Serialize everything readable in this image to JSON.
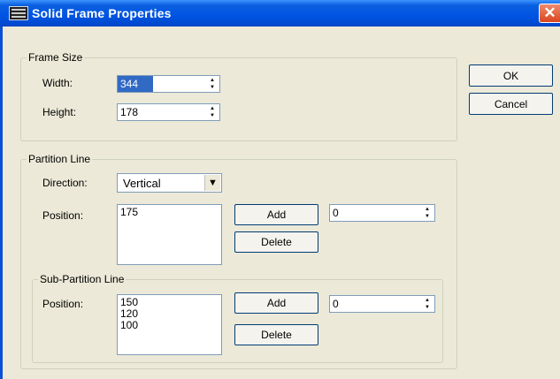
{
  "window": {
    "title": "Solid Frame Properties"
  },
  "frame_size": {
    "legend": "Frame Size",
    "width_label": "Width:",
    "width_value": "344",
    "height_label": "Height:",
    "height_value": "178"
  },
  "partition": {
    "legend": "Partition Line",
    "direction_label": "Direction:",
    "direction_value": "Vertical",
    "position_label": "Position:",
    "positions": [
      "175"
    ],
    "add_label": "Add",
    "delete_label": "Delete",
    "spin_value": "0"
  },
  "sub_partition": {
    "legend": "Sub-Partition Line",
    "position_label": "Position:",
    "positions": [
      "150",
      "120",
      "100"
    ],
    "add_label": "Add",
    "delete_label": "Delete",
    "spin_value": "0"
  },
  "buttons": {
    "ok_label": "OK",
    "cancel_label": "Cancel"
  }
}
